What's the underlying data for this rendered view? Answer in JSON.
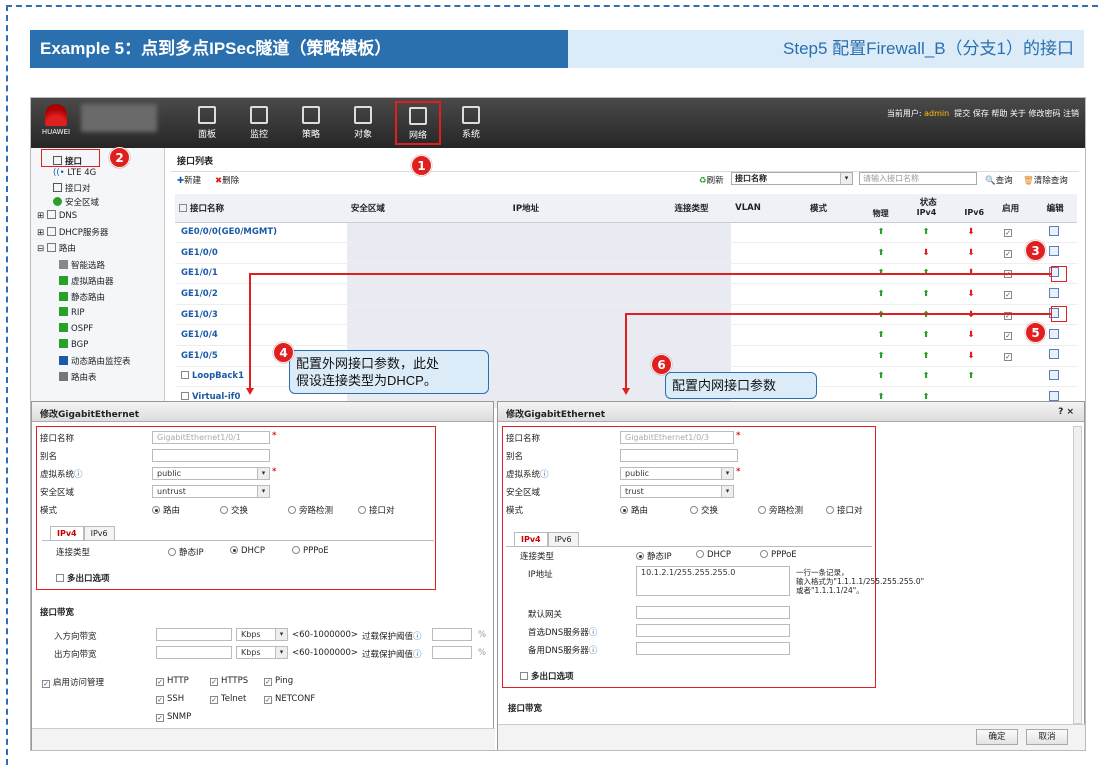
{
  "slide": {
    "title": "Example 5：点到多点IPSec隧道（策略模板）",
    "step": "Step5 配置Firewall_B（分支1）的接口"
  },
  "topbar": {
    "logo_text": "HUAWEI",
    "menus": [
      "面板",
      "监控",
      "策略",
      "对象",
      "网络",
      "系统"
    ],
    "active_menu": "网络",
    "user_label": "当前用户:",
    "user": "admin",
    "links": "提交  保存  帮助  关于  修改密码  注销"
  },
  "sidebar": {
    "items": [
      "接口",
      "LTE 4G",
      "接口对",
      "安全区域",
      "DNS",
      "DHCP服务器",
      "路由",
      "智能选路",
      "虚拟路由器",
      "静态路由",
      "RIP",
      "OSPF",
      "BGP",
      "动态路由监控表",
      "路由表"
    ]
  },
  "iflist": {
    "title": "接口列表",
    "new_btn": "新建",
    "del_btn": "删除",
    "refresh_btn": "刷新",
    "filter_select": "接口名称",
    "search_placeholder": "请输入接口名称",
    "query_btn": "查询",
    "clear_btn": "清除查询",
    "columns": [
      "接口名称",
      "安全区域",
      "IP地址",
      "连接类型",
      "VLAN",
      "模式",
      "状态",
      "启用",
      "编辑"
    ],
    "status_sub": [
      "物理",
      "IPv4",
      "IPv6"
    ],
    "rows": [
      {
        "name": "GE0/0/0(GE0/MGMT)",
        "s": [
          "up",
          "up",
          "down"
        ]
      },
      {
        "name": "GE1/0/0",
        "s": [
          "up",
          "down",
          "down"
        ]
      },
      {
        "name": "GE1/0/1",
        "s": [
          "up",
          "up",
          "down"
        ]
      },
      {
        "name": "GE1/0/2",
        "s": [
          "up",
          "up",
          "down"
        ]
      },
      {
        "name": "GE1/0/3",
        "s": [
          "up",
          "up",
          "down"
        ]
      },
      {
        "name": "GE1/0/4",
        "s": [
          "up",
          "up",
          "down"
        ]
      },
      {
        "name": "GE1/0/5",
        "s": [
          "up",
          "up",
          "down"
        ]
      },
      {
        "name": "LoopBack1",
        "s": [
          "up",
          "up",
          "up"
        ]
      },
      {
        "name": "Virtual-if0",
        "s": [
          "up",
          "up",
          ""
        ]
      }
    ]
  },
  "dlg_left": {
    "title": "修改GigabitEthernet",
    "fields": {
      "name_label": "接口名称",
      "name_value": "GigabitEthernet1/0/1",
      "alias_label": "别名",
      "vsys_label": "虚拟系统",
      "vsys_value": "public",
      "zone_label": "安全区域",
      "zone_value": "untrust",
      "mode_label": "模式"
    },
    "modes": [
      "路由",
      "交换",
      "旁路检测",
      "接口对"
    ],
    "tabs": [
      "IPv4",
      "IPv6"
    ],
    "conn_label": "连接类型",
    "conn_opts": [
      "静态IP",
      "DHCP",
      "PPPoE"
    ],
    "multi_exit": "多出口选项",
    "bw_section": "接口带宽",
    "in_bw": "入方向带宽",
    "out_bw": "出方向带宽",
    "unit": "Kbps",
    "range": "<60-1000000>",
    "overload": "过载保护阈值",
    "pct": "%",
    "access_mgmt": "启用访问管理",
    "services": [
      "HTTP",
      "HTTPS",
      "Ping",
      "SSH",
      "Telnet",
      "NETCONF",
      "SNMP"
    ]
  },
  "dlg_right": {
    "title": "修改GigabitEthernet",
    "close": "? ×",
    "name_value": "GigabitEthernet1/0/3",
    "zone_value": "trust",
    "ip_label": "IP地址",
    "ip_value": "10.1.2.1/255.255.255.0",
    "ip_hint": "一行一条记录，\n输入格式为\"1.1.1.1/255.255.255.0\"\n或者\"1.1.1.1/24\"。",
    "gw_label": "默认网关",
    "dns1_label": "首选DNS服务器",
    "dns2_label": "备用DNS服务器",
    "ok": "确定",
    "cancel": "取消"
  },
  "callouts": {
    "c4": "配置外网接口参数，此处\n假设连接类型为DHCP。",
    "c6": "配置内网接口参数"
  },
  "badges": [
    "1",
    "2",
    "3",
    "4",
    "5",
    "6"
  ],
  "colors": {
    "accent": "#2a6fae",
    "red": "#e02020",
    "green": "#2aa02a"
  }
}
